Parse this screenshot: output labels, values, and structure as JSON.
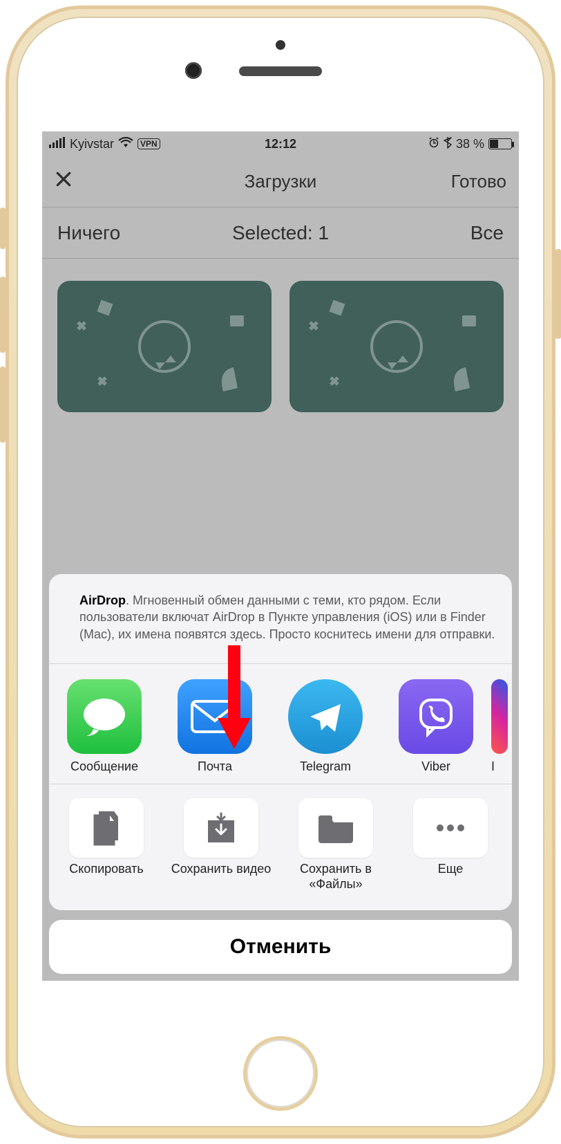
{
  "status": {
    "carrier": "Kyivstar",
    "vpn": "VPN",
    "time": "12:12",
    "battery_pct": "38 %"
  },
  "nav": {
    "title": "Загрузки",
    "done": "Готово"
  },
  "selection": {
    "none": "Ничего",
    "count": "Selected: 1",
    "all": "Все"
  },
  "airdrop": {
    "bold": "AirDrop",
    "text": ". Мгновенный обмен данными с теми, кто рядом. Если пользователи включат AirDrop в Пункте управления (iOS) или в Finder (Mac), их имена появятся здесь. Просто коснитесь имени для отправки."
  },
  "apps": [
    {
      "label": "Сообщение",
      "id": "messages"
    },
    {
      "label": "Почта",
      "id": "mail"
    },
    {
      "label": "Telegram",
      "id": "telegram"
    },
    {
      "label": "Viber",
      "id": "viber"
    },
    {
      "label": "I",
      "id": "instagram"
    }
  ],
  "actions": [
    {
      "label": "Скопировать",
      "id": "copy"
    },
    {
      "label": "Сохранить видео",
      "id": "save-video"
    },
    {
      "label": "Сохранить в «Файлы»",
      "id": "save-files"
    },
    {
      "label": "Еще",
      "id": "more"
    }
  ],
  "cancel": "Отменить"
}
